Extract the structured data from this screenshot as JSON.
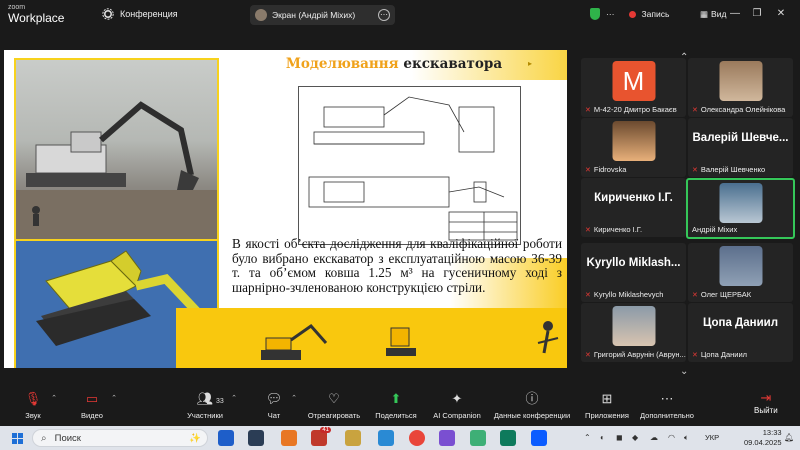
{
  "app": {
    "logo_line1": "zoom",
    "logo_line2": "Workplace",
    "meeting_label": "Конференция",
    "screen_share_label": "Экран (Андрій Міхих)",
    "record_label": "Запись",
    "view_label": "Вид"
  },
  "slide": {
    "title_part1": "Моделювання ",
    "title_part2": "екскаватора",
    "body": "В якості об’єкта дослідження для кваліфікаційної роботи було вибрано екскаватор з експлуатаційною масою 36-39 т. та об’ємом ковша 1.25 м³ на гусеничному ході з шарнірно-зчленованою конструкцією стріли."
  },
  "participants": [
    {
      "name": "М-42-20 Дмитро Бакаєв",
      "avatar_letter": "M",
      "type": "letter",
      "muted": true
    },
    {
      "name": "Олександра Олейнікова",
      "type": "photo",
      "muted": true
    },
    {
      "name": "Fidrovska",
      "type": "photo",
      "muted": true
    },
    {
      "name": "Валерій Шевченко",
      "display": "Валерій Шевче...",
      "type": "text",
      "muted": true
    },
    {
      "name": "Кириченко І.Г.",
      "display": "Кириченко І.Г.",
      "type": "text",
      "muted": true
    },
    {
      "name": "Андрій Міхих",
      "type": "photo",
      "muted": false,
      "active": true
    },
    {
      "name": "Kyryllo Miklashevych",
      "display": "Kyryllo Miklash...",
      "type": "text",
      "muted": true
    },
    {
      "name": "Олег ЩЕРБАК",
      "type": "photo",
      "muted": true
    },
    {
      "name": "Григорий Аврунін (Аврун...",
      "type": "photo",
      "muted": true
    },
    {
      "name": "Цопа Даниил",
      "display": "Цопа Даниил",
      "type": "text",
      "muted": true
    }
  ],
  "toolbar": {
    "mute": "Звук",
    "video": "Видео",
    "participants": "Участники",
    "participants_count": "33",
    "chat": "Чат",
    "react": "Отреагировать",
    "share": "Поделиться",
    "companion": "AI Companion",
    "meeting_data": "Данные конференции",
    "apps": "Приложения",
    "more": "Дополнительно",
    "exit": "Выйти"
  },
  "taskbar": {
    "search_placeholder": "Поиск",
    "notification_count": "41",
    "language": "УКР",
    "time": "13:33",
    "date": "09.04.2025"
  },
  "colors": {
    "accent_green": "#35c759",
    "record_red": "#e53935",
    "slide_yellow": "#f9c80e",
    "title_orange": "#f0a21b"
  }
}
